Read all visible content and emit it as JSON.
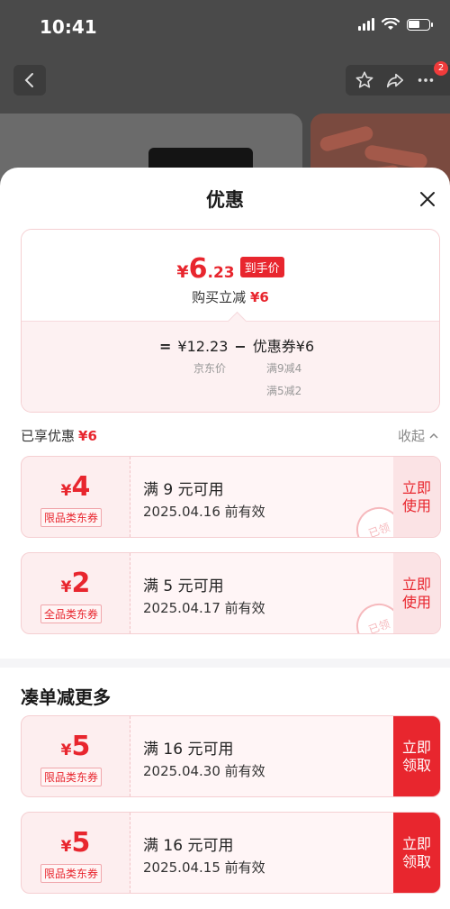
{
  "status_bar": {
    "time": "10:41"
  },
  "background_page": {
    "cart_badge": "2"
  },
  "sheet": {
    "title": "优惠",
    "summary": {
      "price_symbol": "¥",
      "price_integer": "6",
      "price_decimal": ".23",
      "price_tag": "到手价",
      "reduce_label": "购买立减",
      "reduce_amount": "¥6",
      "equals": "=",
      "jd_price": "¥12.23",
      "minus": "−",
      "coupon_label": "优惠券¥6",
      "jd_price_label": "京东价",
      "conditions": [
        "满9减4",
        "满5减2"
      ]
    },
    "enjoyed": {
      "label": "已享优惠",
      "amount": "¥6",
      "collapse": "收起"
    },
    "used_coupons": [
      {
        "symbol": "¥",
        "amount": "4",
        "type": "限品类东券",
        "condition": "满 9 元可用",
        "date": "2025.04.16 前有效",
        "action": [
          "立即",
          "使用"
        ],
        "stamp": "已领"
      },
      {
        "symbol": "¥",
        "amount": "2",
        "type": "全品类东券",
        "condition": "满 5 元可用",
        "date": "2025.04.17 前有效",
        "action": [
          "立即",
          "使用"
        ],
        "stamp": "已领"
      }
    ],
    "more_title": "凑单减更多",
    "more_coupons": [
      {
        "symbol": "¥",
        "amount": "5",
        "type": "限品类东券",
        "condition": "满 16 元可用",
        "date": "2025.04.30 前有效",
        "action": [
          "立即",
          "领取"
        ]
      },
      {
        "symbol": "¥",
        "amount": "5",
        "type": "限品类东券",
        "condition": "满 16 元可用",
        "date": "2025.04.15 前有效",
        "action": [
          "立即",
          "领取"
        ]
      }
    ]
  },
  "colors": {
    "accent": "#e8262e",
    "coupon_bg": "#fdeeef",
    "border": "#f5cfd2"
  }
}
